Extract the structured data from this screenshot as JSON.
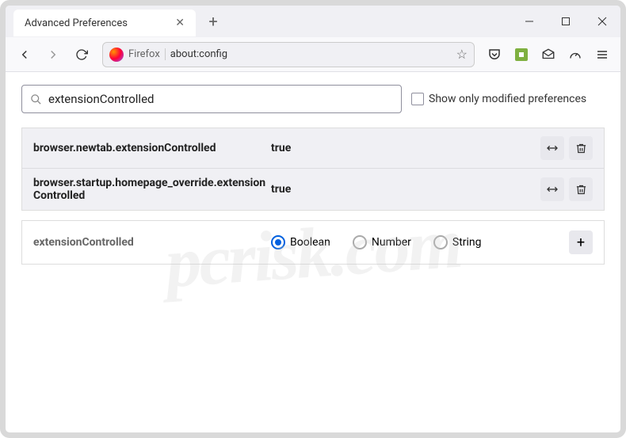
{
  "tab": {
    "title": "Advanced Preferences"
  },
  "addressbar": {
    "fx_label": "Firefox",
    "url": "about:config"
  },
  "search": {
    "value": "extensionControlled"
  },
  "checkbox": {
    "label": "Show only modified preferences"
  },
  "prefs": [
    {
      "name": "browser.newtab.extensionControlled",
      "value": "true"
    },
    {
      "name": "browser.startup.homepage_override.extensionControlled",
      "value": "true"
    }
  ],
  "new_pref": {
    "name": "extensionControlled",
    "types": [
      "Boolean",
      "Number",
      "String"
    ],
    "selected": 0
  },
  "watermark": "pcrisk.com"
}
